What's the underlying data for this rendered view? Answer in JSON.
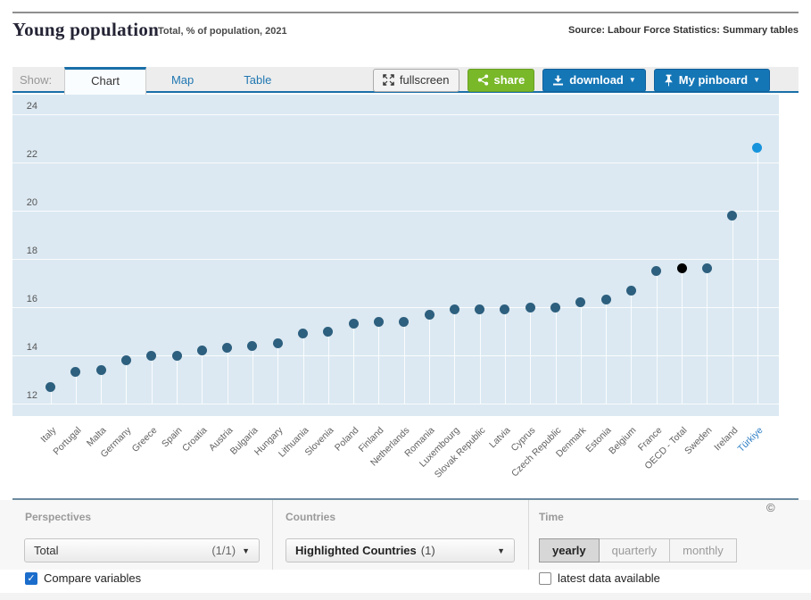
{
  "header": {
    "title": "Young population",
    "subtitle": "Total, % of population, 2021",
    "source": "Source: Labour Force Statistics: Summary tables"
  },
  "toolbar": {
    "show_label": "Show:",
    "tabs": [
      {
        "label": "Chart",
        "active": true
      },
      {
        "label": "Map",
        "active": false
      },
      {
        "label": "Table",
        "active": false
      }
    ],
    "buttons": {
      "fullscreen": "fullscreen",
      "share": "share",
      "download": "download",
      "pinboard": "My pinboard"
    }
  },
  "icons": {
    "caret": "▼",
    "check": "✓"
  },
  "chart_data": {
    "type": "scatter",
    "title": "Young population",
    "subtitle": "Total, % of population, 2021",
    "xlabel": "",
    "ylabel": "% of population",
    "ylim": [
      11.5,
      24.8
    ],
    "yticks": [
      12,
      14,
      16,
      18,
      20,
      22,
      24
    ],
    "grid": true,
    "background": "#dce9f2",
    "point_color": "#2d5f7e",
    "point_overrides": {
      "OECD - Total": "#000000",
      "Türkiye": "#1793dc"
    },
    "highlight_category": "Türkiye",
    "highlight_label_color": "#2e7fc6",
    "categories": [
      "Italy",
      "Portugal",
      "Malta",
      "Germany",
      "Greece",
      "Spain",
      "Croatia",
      "Austria",
      "Bulgaria",
      "Hungary",
      "Lithuania",
      "Slovenia",
      "Poland",
      "Finland",
      "Netherlands",
      "Romania",
      "Luxembourg",
      "Slovak Republic",
      "Latvia",
      "Cyprus",
      "Czech Republic",
      "Denmark",
      "Estonia",
      "Belgium",
      "France",
      "OECD - Total",
      "Sweden",
      "Ireland",
      "Türkiye"
    ],
    "values": [
      12.7,
      13.3,
      13.4,
      13.8,
      14.0,
      14.0,
      14.2,
      14.3,
      14.4,
      14.5,
      14.9,
      15.0,
      15.3,
      15.4,
      15.4,
      15.7,
      15.9,
      15.9,
      15.9,
      16.0,
      16.0,
      16.2,
      16.3,
      16.7,
      17.5,
      17.6,
      17.6,
      19.8,
      22.6
    ]
  },
  "footer": {
    "perspectives": {
      "header": "Perspectives",
      "dropdown_value": "Total",
      "dropdown_count": "(1/1)",
      "checkbox_label": "Compare variables",
      "checkbox_checked": true
    },
    "countries": {
      "header": "Countries",
      "dropdown_value": "Highlighted Countries",
      "dropdown_count": "(1)"
    },
    "time": {
      "header": "Time",
      "options": [
        "yearly",
        "quarterly",
        "monthly"
      ],
      "selected": "yearly",
      "checkbox_label": "latest data available",
      "checkbox_checked": false,
      "copyright": "©"
    }
  }
}
